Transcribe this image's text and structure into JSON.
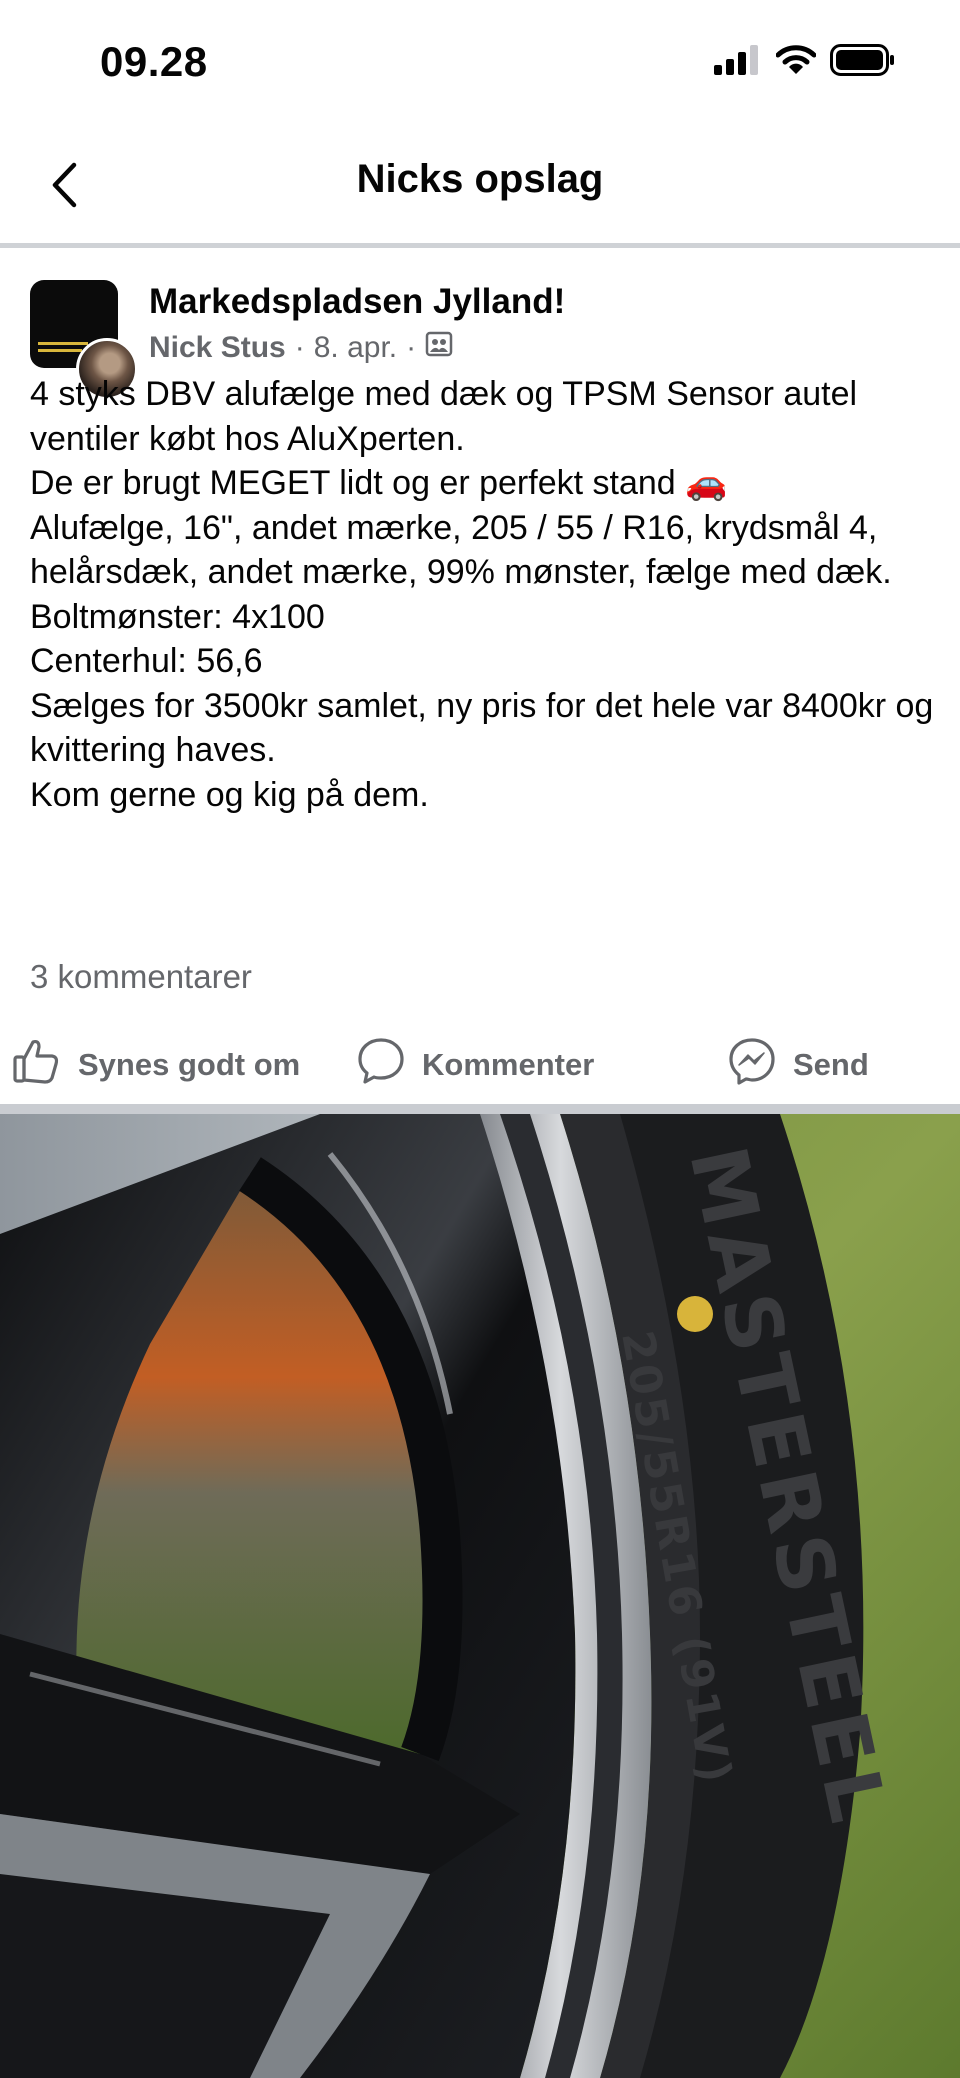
{
  "status_bar": {
    "time": "09.28"
  },
  "nav": {
    "title": "Nicks opslag"
  },
  "post": {
    "group_name": "Markedspladsen Jylland!",
    "author": "Nick Stus",
    "separator": "·",
    "date": "8. apr.",
    "body": [
      "4 styks DBV alufælge med dæk og TPSM Sensor autel ventiler købt hos AluXperten.",
      "De er brugt MEGET lidt og er perfekt stand 🚗",
      "",
      "Alufælge, 16\", andet mærke, 205 / 55 / R16, krydsmål 4, helårsdæk, andet mærke, 99% mønster, fælge med dæk.",
      "Boltmønster: 4x100",
      "Centerhul: 56,6",
      "",
      "Sælges for 3500kr samlet, ny pris for det hele var 8400kr og kvittering haves.",
      "Kom gerne og kig på dem."
    ],
    "comment_count": "3 kommentarer"
  },
  "actions": {
    "like": "Synes godt om",
    "comment": "Kommenter",
    "send": "Send"
  },
  "photo": {
    "tyre_brand_text": "MASTERSTEEL",
    "tyre_size_text": "205/55R16 (91V)"
  },
  "colors": {
    "secondary_text": "#65676b",
    "divider": "#c9ccd1",
    "primary_text": "#050505"
  }
}
